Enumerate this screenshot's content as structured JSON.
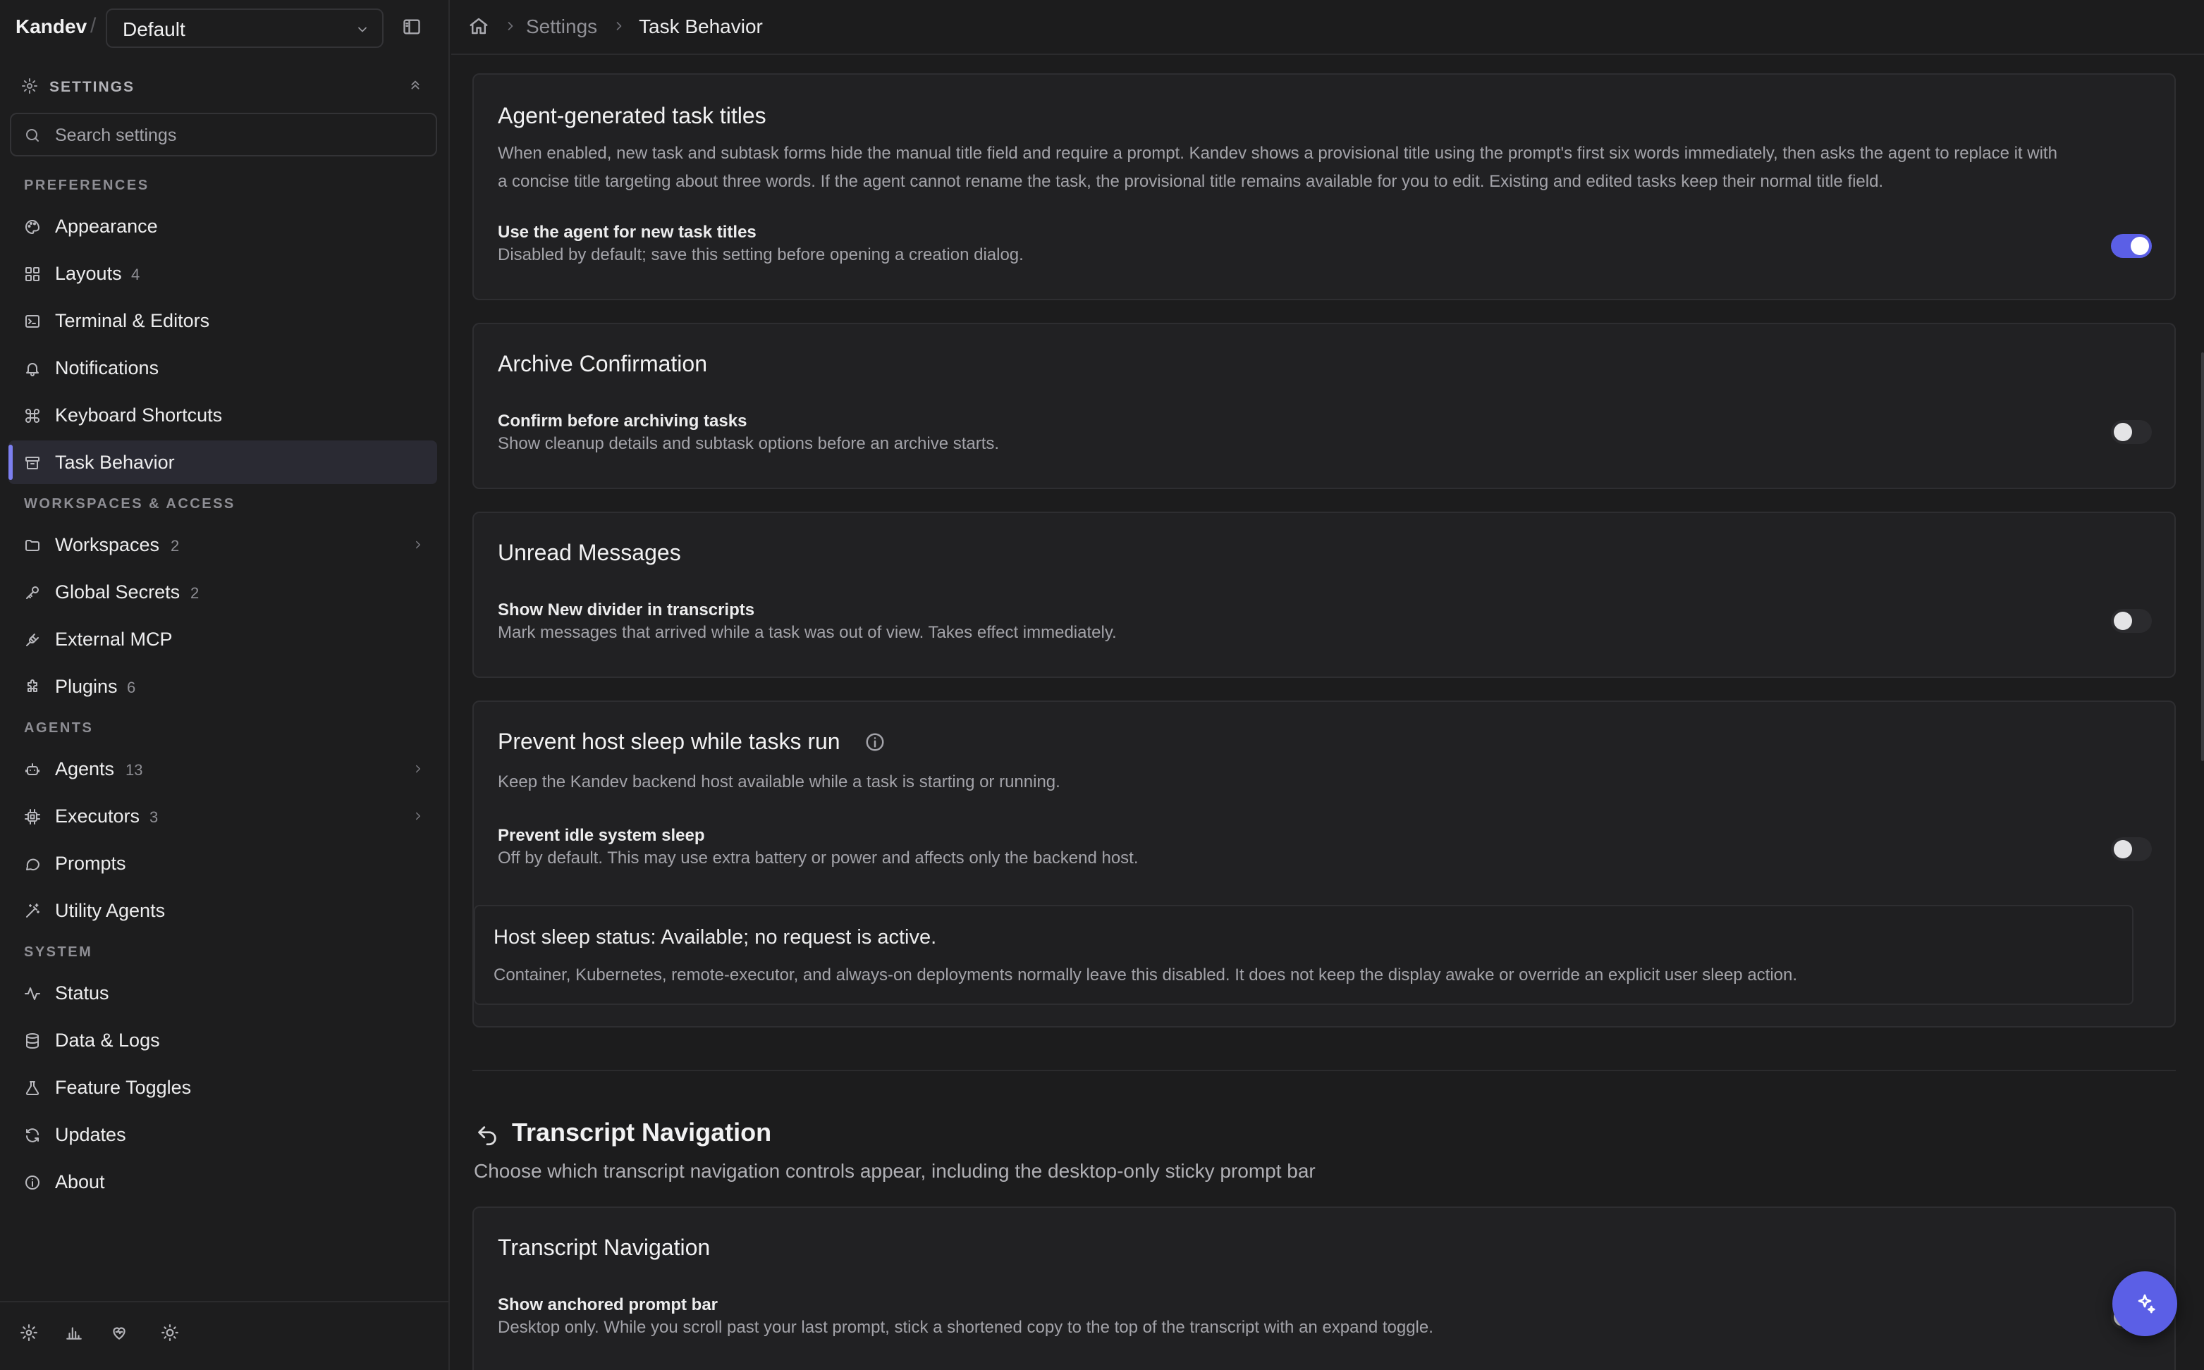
{
  "app": {
    "brand": "Kandev",
    "brand_separator": "/",
    "workspace": "Default"
  },
  "sidebar": {
    "header": "SETTINGS",
    "search_placeholder": "Search settings",
    "sections": [
      {
        "title": "PREFERENCES",
        "items": [
          {
            "label": "Appearance",
            "icon": "palette-icon"
          },
          {
            "label": "Layouts",
            "count": "4",
            "icon": "layout-icon"
          },
          {
            "label": "Terminal & Editors",
            "icon": "terminal-icon"
          },
          {
            "label": "Notifications",
            "icon": "bell-icon"
          },
          {
            "label": "Keyboard Shortcuts",
            "icon": "command-icon"
          },
          {
            "label": "Task Behavior",
            "icon": "archive-icon",
            "active": true
          }
        ]
      },
      {
        "title": "WORKSPACES & ACCESS",
        "items": [
          {
            "label": "Workspaces",
            "count": "2",
            "icon": "folder-icon",
            "expandable": true
          },
          {
            "label": "Global Secrets",
            "count": "2",
            "icon": "key-icon"
          },
          {
            "label": "External MCP",
            "icon": "plug-icon"
          },
          {
            "label": "Plugins",
            "count": "6",
            "icon": "puzzle-icon"
          }
        ]
      },
      {
        "title": "AGENTS",
        "items": [
          {
            "label": "Agents",
            "count": "13",
            "icon": "bot-icon",
            "expandable": true
          },
          {
            "label": "Executors",
            "count": "3",
            "icon": "cpu-icon",
            "expandable": true
          },
          {
            "label": "Prompts",
            "icon": "message-icon"
          },
          {
            "label": "Utility Agents",
            "icon": "wand-icon"
          }
        ]
      },
      {
        "title": "SYSTEM",
        "items": [
          {
            "label": "Status",
            "icon": "activity-icon"
          },
          {
            "label": "Data & Logs",
            "icon": "database-icon"
          },
          {
            "label": "Feature Toggles",
            "icon": "flask-icon"
          },
          {
            "label": "Updates",
            "icon": "refresh-icon"
          },
          {
            "label": "About",
            "icon": "info-icon"
          }
        ]
      }
    ]
  },
  "breadcrumb": {
    "parent": "Settings",
    "current": "Task Behavior"
  },
  "cards": {
    "agent_titles": {
      "title": "Agent-generated task titles",
      "desc_line1": "When enabled, new task and subtask forms hide the manual title field and require a prompt. Kandev shows a provisional title using the prompt's first six words immediately, then asks the agent to replace it with",
      "desc_line2": "a concise title targeting about three words. If the agent cannot rename the task, the provisional title remains available for you to edit. Existing and edited tasks keep their normal title field.",
      "row_title": "Use the agent for new task titles",
      "row_desc": "Disabled by default; save this setting before opening a creation dialog.",
      "enabled": true
    },
    "archive": {
      "title": "Archive Confirmation",
      "row_title": "Confirm before archiving tasks",
      "row_desc": "Show cleanup details and subtask options before an archive starts.",
      "enabled": false
    },
    "unread": {
      "title": "Unread Messages",
      "row_title": "Show New divider in transcripts",
      "row_desc": "Mark messages that arrived while a task was out of view. Takes effect immediately.",
      "enabled": false
    },
    "sleep": {
      "title": "Prevent host sleep while tasks run",
      "desc": "Keep the Kandev backend host available while a task is starting or running.",
      "row_title": "Prevent idle system sleep",
      "row_desc": "Off by default. This may use extra battery or power and affects only the backend host.",
      "enabled": false,
      "status_title": "Host sleep status: Available; no request is active.",
      "status_note": "Container, Kubernetes, remote-executor, and always-on deployments normally leave this disabled. It does not keep the display awake or override an explicit user sleep action."
    }
  },
  "transcript_section": {
    "title": "Transcript Navigation",
    "desc": "Choose which transcript navigation controls appear, including the desktop-only sticky prompt bar",
    "card_title": "Transcript Navigation",
    "row_title": "Show anchored prompt bar",
    "row_desc": "Desktop only. While you scroll past your last prompt, stick a shortened copy to the top of the transcript with an expand toggle."
  },
  "colors": {
    "accent": "#5b5fe6",
    "active_bar": "#7c7ff0",
    "background": "#1c1c1d",
    "card": "#212123"
  }
}
